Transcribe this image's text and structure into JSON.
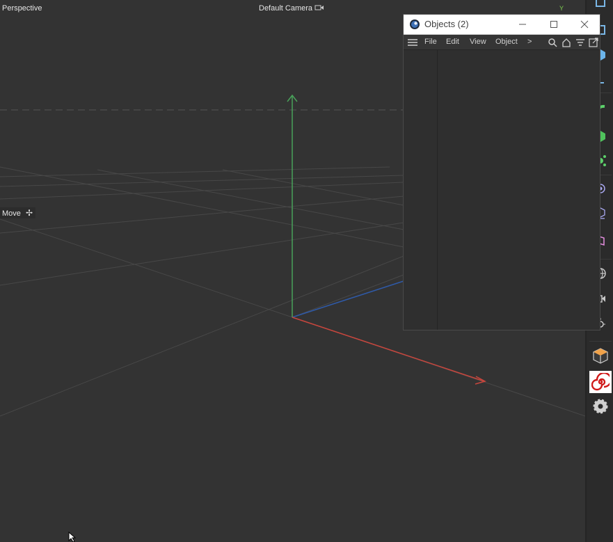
{
  "viewport": {
    "view_label": "Perspective",
    "camera_label": "Default Camera",
    "camera_icon": "camera-icon",
    "axis_indicator": "Y",
    "tool_label": "Move",
    "tool_icon": "move-icon"
  },
  "objects_window": {
    "title": "Objects (2)",
    "window_buttons": [
      "minimize",
      "maximize",
      "close"
    ],
    "menu": {
      "items": [
        "File",
        "Edit",
        "View",
        "Object"
      ],
      "more": ">"
    },
    "toolbar_icons": [
      "search-icon",
      "home-icon",
      "filter-icon",
      "new-window-icon"
    ]
  },
  "right_strip": {
    "icons": [
      "cube-icon",
      "spline-icon",
      "generator-icon",
      "deformer-icon",
      "field-icon",
      "scene-icon",
      "camera-icon",
      "light-icon",
      "cube-package-icon",
      "spiral-plugin-icon",
      "gear-icon"
    ]
  },
  "colors": {
    "x_axis": "#c8463d",
    "y_axis": "#49a25a",
    "z_axis": "#2f5aa8",
    "grid": "#4d4d4d"
  }
}
